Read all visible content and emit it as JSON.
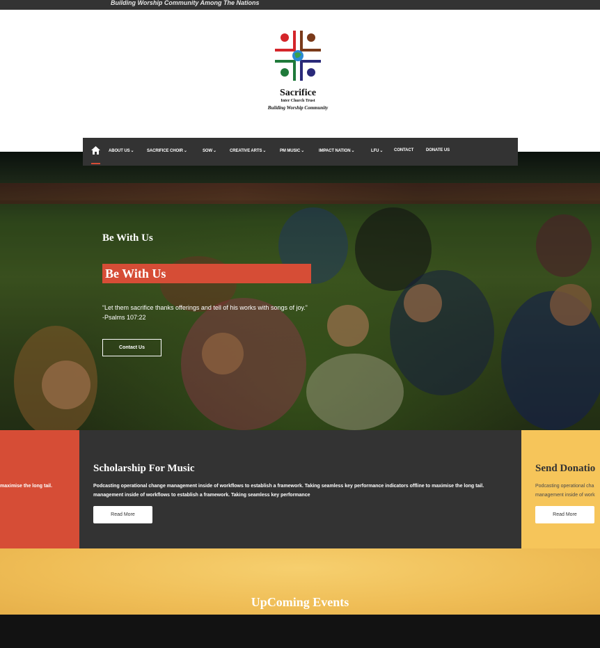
{
  "topbar": {
    "tagline": "Building Worship Community Among The Nations"
  },
  "logo": {
    "name": "Sacrifice",
    "subtitle": "Inter Church Trust",
    "tagline": "Building Worship Community",
    "icon": "cross-hands-globe-logo"
  },
  "nav": {
    "home_icon": "home-icon",
    "items": [
      {
        "label": "ABOUT US",
        "dropdown": true
      },
      {
        "label": "SACRIFICE CHOIR",
        "dropdown": true
      },
      {
        "label": "SOW",
        "dropdown": true
      },
      {
        "label": "CREATIVE ARTS",
        "dropdown": true
      },
      {
        "label": "PM MUSIC",
        "dropdown": true
      },
      {
        "label": "IMPACT NATION",
        "dropdown": true
      },
      {
        "label": "LFU",
        "dropdown": true
      },
      {
        "label": "CONTACT",
        "dropdown": false
      },
      {
        "label": "DONATE US",
        "dropdown": false
      }
    ]
  },
  "hero": {
    "eyebrow": "Be With Us",
    "title": "Be With Us",
    "quote": "“Let them sacrifice thanks offerings and tell of his works with songs of joy.” -Psalms 107:22",
    "button": "Contact Us"
  },
  "cards": {
    "red": {
      "text": "maximise the long tail."
    },
    "dark": {
      "title": "Scholarship For Music",
      "line1": "Podcasting operational change management inside of workflows to establish a framework. Taking seamless key performance indicators offline to maximise the long tail.",
      "line2": "management inside of workflows to establish a framework. Taking seamless key performance",
      "button": "Read More"
    },
    "yellow": {
      "title": "Send Donatio",
      "line1": "Podcasting operational cha",
      "line2": "management inside of work",
      "button": "Read More"
    }
  },
  "events": {
    "title": "UpComing Events"
  },
  "colors": {
    "accent": "#d64d36",
    "dark": "#333333",
    "yellow": "#f6c55a"
  }
}
